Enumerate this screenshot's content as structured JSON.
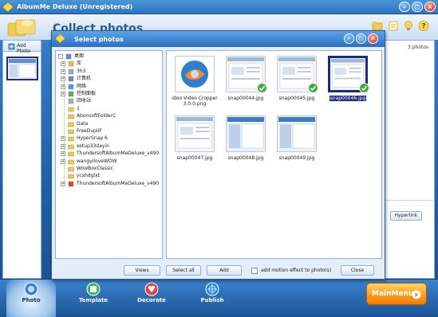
{
  "app": {
    "title": "AlbumMe Deluxe (Unregistered)",
    "page_heading": "Collect photos",
    "add_photo_label": "Add Photo",
    "photo_count": "3 photos",
    "hyperlink_label": "Hyperlink",
    "colors": {
      "accent": "#2f74bf",
      "selection": "#1c2a80",
      "orange": "#ff9d1e"
    }
  },
  "nav": {
    "tabs": [
      {
        "label": "Photo",
        "icon": "camera-icon"
      },
      {
        "label": "Template",
        "icon": "template-icon"
      },
      {
        "label": "Decorate",
        "icon": "decorate-icon"
      },
      {
        "label": "Publish",
        "icon": "publish-icon"
      }
    ],
    "main_menu_label": "MainMenu"
  },
  "dialog": {
    "title": "Select photos",
    "tree": [
      {
        "label": "桌面",
        "expander": "-",
        "icon": "desktop",
        "indent": 0
      },
      {
        "label": "库",
        "expander": "+",
        "icon": "library",
        "indent": 1
      },
      {
        "label": "3h3",
        "expander": "+",
        "icon": "user",
        "indent": 1
      },
      {
        "label": "计算机",
        "expander": "+",
        "icon": "computer",
        "indent": 1
      },
      {
        "label": "网络",
        "expander": "+",
        "icon": "network",
        "indent": 1
      },
      {
        "label": "控制面板",
        "expander": "+",
        "icon": "control",
        "indent": 1
      },
      {
        "label": "回收站",
        "expander": "",
        "icon": "recycle",
        "indent": 1
      },
      {
        "label": "1",
        "expander": "",
        "icon": "folder",
        "indent": 1
      },
      {
        "label": "AbonsoftFolderC",
        "expander": "",
        "icon": "folder",
        "indent": 1
      },
      {
        "label": "Data",
        "expander": "",
        "icon": "folder",
        "indent": 1
      },
      {
        "label": "FreeDupliF",
        "expander": "",
        "icon": "folder",
        "indent": 1
      },
      {
        "label": "HyperSnap 6",
        "expander": "+",
        "icon": "folder",
        "indent": 1
      },
      {
        "label": "setup33dayin",
        "expander": "+",
        "icon": "folder",
        "indent": 1
      },
      {
        "label": "ThundersoftAlbumMeDeluxe_v490",
        "expander": "+",
        "icon": "folder",
        "indent": 1
      },
      {
        "label": "wangyiloveWOW",
        "expander": "+",
        "icon": "folder",
        "indent": 1
      },
      {
        "label": "WowBoxClassic",
        "expander": "",
        "icon": "folder",
        "indent": 1
      },
      {
        "label": "ycshdglxt",
        "expander": "",
        "icon": "folder",
        "indent": 1
      },
      {
        "label": "ThundersoftAlbumMeDeluxe_v490",
        "expander": "+",
        "icon": "app",
        "indent": 1
      }
    ],
    "files": [
      {
        "name": "idoo Video Cropper 3.0.0.png",
        "checked": false,
        "selected": false,
        "thumb": "app-logo"
      },
      {
        "name": "snap00044.jpg",
        "checked": true,
        "selected": false,
        "thumb": "screenshot"
      },
      {
        "name": "snap00045.jpg",
        "checked": true,
        "selected": false,
        "thumb": "screenshot"
      },
      {
        "name": "snap00046.jpg",
        "checked": true,
        "selected": true,
        "thumb": "screenshot-selected"
      },
      {
        "name": "snap00047.jpg",
        "checked": false,
        "selected": false,
        "thumb": "screenshot"
      },
      {
        "name": "snap00048.jpg",
        "checked": false,
        "selected": false,
        "thumb": "screenshot-blue"
      },
      {
        "name": "snap00049.jpg",
        "checked": false,
        "selected": false,
        "thumb": "screenshot-blue"
      }
    ],
    "buttons": {
      "views": "Views",
      "select_all": "Select all",
      "add": "Add",
      "close": "Close"
    },
    "motion_label": "add motion effect to photo(s)",
    "motion_checked": false
  }
}
